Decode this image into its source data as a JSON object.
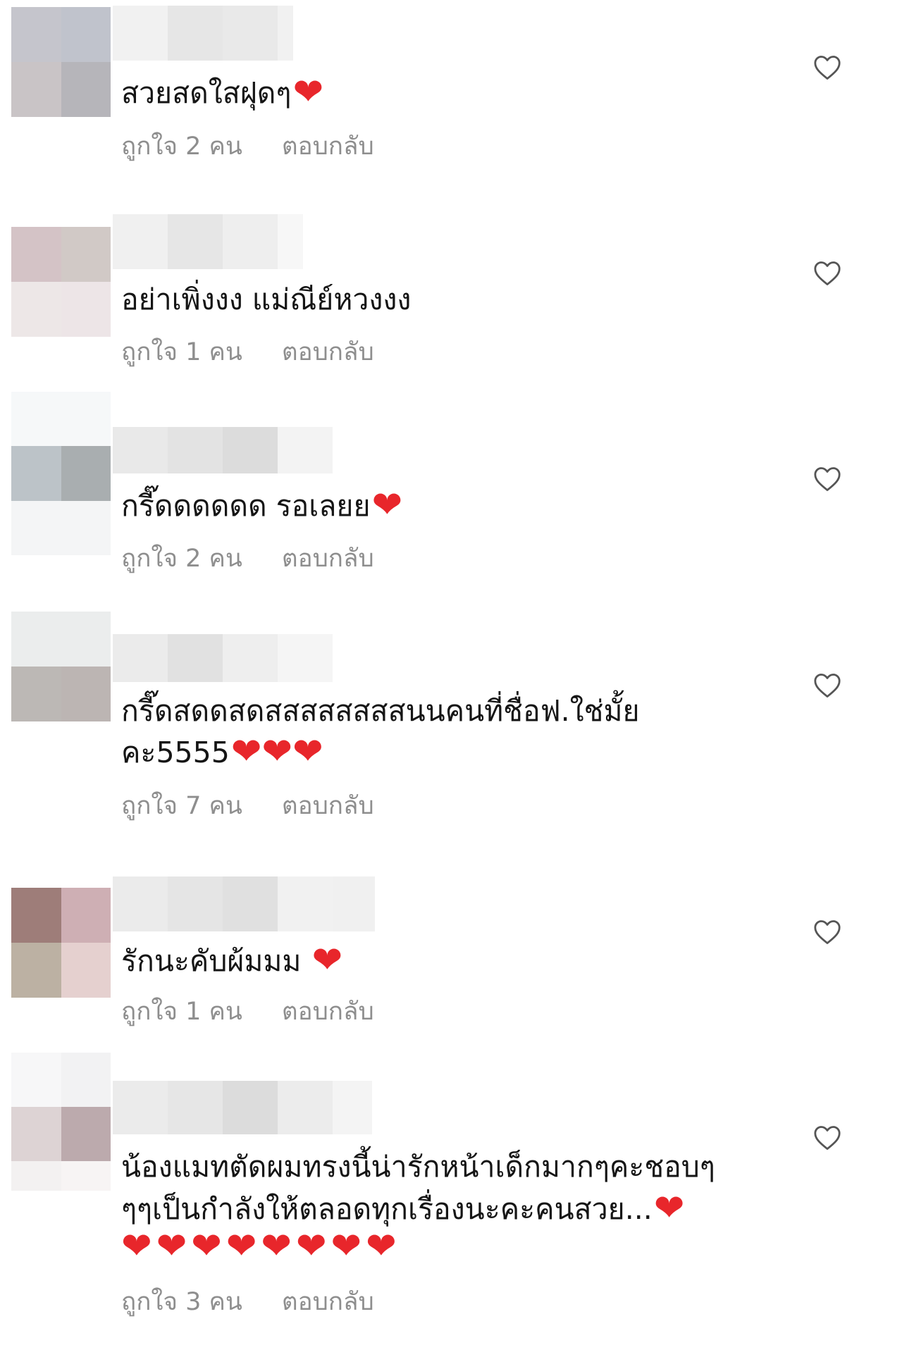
{
  "comments": [
    {
      "text": "สวยสดใสฝุดๆ",
      "emoji": "❤",
      "likes_label": "ถูกใจ 2 คน",
      "reply_label": "ตอบกลับ"
    },
    {
      "text": "อย่าเพิ่งงง แม่ณีย์หวงงง",
      "emoji": "",
      "likes_label": "ถูกใจ 1 คน",
      "reply_label": "ตอบกลับ"
    },
    {
      "text": "กรี๊ดดดดดด รอเลยย",
      "emoji": "❤",
      "likes_label": "ถูกใจ 2 คน",
      "reply_label": "ตอบกลับ"
    },
    {
      "text": "กรี๊ดสดดสดสสสสสสสสนนคนที่ชื่อฟ.ใช่มั้ย\nคะ5555",
      "emoji": "❤❤❤",
      "likes_label": "ถูกใจ 7 คน",
      "reply_label": "ตอบกลับ"
    },
    {
      "text": "รักนะคับผ้มมม ",
      "emoji": "❤",
      "likes_label": "ถูกใจ 1 คน",
      "reply_label": "ตอบกลับ"
    },
    {
      "text": "น้องแมทตัดผมทรงนี้น่ารักหน้าเด็กมากๆคะชอบๆ\nๆๆเป็นกำลังให้ตลอดทุกเรื่องนะคะคนสวย...",
      "emoji": "❤",
      "extra_emoji_line": "❤❤❤❤❤❤❤❤",
      "likes_label": "ถูกใจ 3 คน",
      "reply_label": "ตอบกลับ"
    }
  ],
  "colors": {
    "meta_text": "#8e8e8e",
    "heart_emoji": "#e8262b",
    "like_icon_stroke": "#555555"
  },
  "icons": {
    "like": "heart-outline-icon"
  }
}
